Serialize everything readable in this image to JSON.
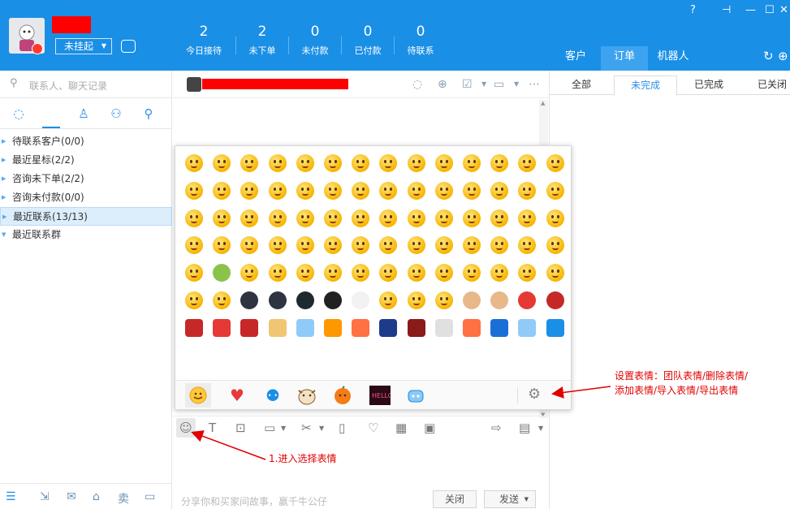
{
  "header": {
    "status_label": "未挂起",
    "stats": [
      {
        "value": "2",
        "label": "今日接待"
      },
      {
        "value": "2",
        "label": "未下单"
      },
      {
        "value": "0",
        "label": "未付款"
      },
      {
        "value": "0",
        "label": "已付款"
      },
      {
        "value": "0",
        "label": "待联系"
      }
    ],
    "right_tabs": [
      "客户",
      "订单",
      "机器人"
    ],
    "active_right_tab": "订单"
  },
  "left": {
    "search_placeholder": "联系人、聊天记录",
    "tree": [
      {
        "label": "待联系客户(0/0)"
      },
      {
        "label": "最近星标(2/2)"
      },
      {
        "label": "咨询未下单(2/2)"
      },
      {
        "label": "咨询未付款(0/0)"
      },
      {
        "label": "最近联系(13/13)",
        "selected": true
      },
      {
        "label": "最近联系群"
      }
    ],
    "bottom_icons": [
      "menu-icon",
      "export-icon",
      "mail-icon",
      "shop-icon",
      "sell-icon",
      "window-icon"
    ],
    "sell_label": "卖"
  },
  "chat": {
    "input_placeholder": "分享你和买家间故事，赢千牛公仔",
    "close_label": "关闭",
    "send_label": "发送"
  },
  "orders": {
    "tabs": [
      "全部",
      "未完成",
      "已完成",
      "已关闭"
    ],
    "active_tab": "未完成"
  },
  "emoji_panel": {
    "rows": 7,
    "columns": 14,
    "categories": [
      "smiley-icon",
      "heart-icon",
      "group-icon",
      "cow-icon",
      "orange-icon",
      "hello-kitty-icon",
      "robot-icon"
    ],
    "settings_icon": "gear-icon"
  },
  "annotations": {
    "settings_note_line1": "设置表情：团队表情/删除表情/",
    "settings_note_line2": "添加表情/导入表情/导出表情",
    "emoji_entry_note": "1.进入选择表情"
  },
  "colors": {
    "brand_blue": "#1a8fe6",
    "annotation_red": "#e00000",
    "redaction_red": "#ff0000"
  }
}
